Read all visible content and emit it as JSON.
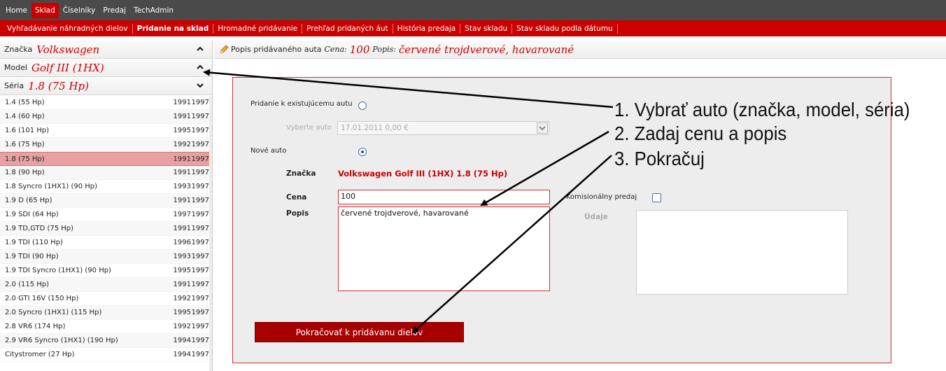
{
  "topnav": [
    {
      "label": "Home",
      "active": false
    },
    {
      "label": "Sklad",
      "active": true
    },
    {
      "label": "Číselníky",
      "active": false
    },
    {
      "label": "Predaj",
      "active": false
    },
    {
      "label": "TechAdmin",
      "active": false
    }
  ],
  "subnav": [
    {
      "label": "Vyhľadávanie náhradných dielov",
      "active": false
    },
    {
      "label": "Pridanie na sklad",
      "active": true
    },
    {
      "label": "Hromadné pridávanie",
      "active": false
    },
    {
      "label": "Prehľad pridaných áut",
      "active": false
    },
    {
      "label": "História predaja",
      "active": false
    },
    {
      "label": "Stav skladu",
      "active": false
    },
    {
      "label": "Stav skladu podla dátumu",
      "active": false
    }
  ],
  "left": {
    "znacka_label": "Značka",
    "znacka_value": "Volkswagen",
    "model_label": "Model",
    "model_value": "Golf III (1HX)",
    "seria_label": "Séria",
    "seria_value": "1.8 (75 Hp)",
    "rows": [
      {
        "name": "1.4 (55 Hp)",
        "from": "1991",
        "to": "1997"
      },
      {
        "name": "1.4 (60 Hp)",
        "from": "1991",
        "to": "1997"
      },
      {
        "name": "1.6 (101 Hp)",
        "from": "1995",
        "to": "1997"
      },
      {
        "name": "1.6 (75 Hp)",
        "from": "1992",
        "to": "1997"
      },
      {
        "name": "1.8 (75 Hp)",
        "from": "1991",
        "to": "1997",
        "selected": true
      },
      {
        "name": "1.8 (90 Hp)",
        "from": "1991",
        "to": "1997"
      },
      {
        "name": "1.8 Syncro (1HX1) (90 Hp)",
        "from": "1993",
        "to": "1997"
      },
      {
        "name": "1.9 D (65 Hp)",
        "from": "1991",
        "to": "1997"
      },
      {
        "name": "1.9 SDI (64 Hp)",
        "from": "1997",
        "to": "1997"
      },
      {
        "name": "1.9 TD,GTD (75 Hp)",
        "from": "1991",
        "to": "1997"
      },
      {
        "name": "1.9 TDI (110 Hp)",
        "from": "1996",
        "to": "1997"
      },
      {
        "name": "1.9 TDI (90 Hp)",
        "from": "1993",
        "to": "1997"
      },
      {
        "name": "1.9 TDI Syncro (1HX1) (90 Hp)",
        "from": "1995",
        "to": "1997"
      },
      {
        "name": "2.0 (115 Hp)",
        "from": "1991",
        "to": "1997"
      },
      {
        "name": "2.0 GTI 16V (150 Hp)",
        "from": "1992",
        "to": "1997"
      },
      {
        "name": "2.0 Syncro (1HX1) (115 Hp)",
        "from": "1995",
        "to": "1997"
      },
      {
        "name": "2.8 VR6 (174 Hp)",
        "from": "1992",
        "to": "1997"
      },
      {
        "name": "2.9 VR6 Syncro (1HX1) (190 Hp)",
        "from": "1994",
        "to": "1997"
      },
      {
        "name": "Citystromer (27 Hp)",
        "from": "1994",
        "to": "1997"
      }
    ]
  },
  "header": {
    "title": "Popis pridávaného auta",
    "cena_label": "Cena:",
    "cena_value": "100",
    "popis_label": "Popis:",
    "popis_value": "červené trojdverové, havarované"
  },
  "form": {
    "existing_label": "Pridanie k existujúcemu autu",
    "existing_selected": false,
    "vyberte_label": "Vyberte auto",
    "vyberte_value": "17.01.2011  0,00 €",
    "new_label": "Nové auto",
    "new_selected": true,
    "znacka_label": "Značka",
    "znacka_value": "Volkswagen Golf III (1HX) 1.8 (75 Hp)",
    "cena_label": "Cena",
    "cena_value": "100",
    "popis_label": "Popis",
    "popis_value": "červené trojdverové, havarované",
    "komis_label": "Komisionálny predaj",
    "komis_checked": false,
    "udaje_label": "Údaje",
    "continue_button": "Pokračovať k pridávanu dielov"
  },
  "annotations": [
    "1. Vybrať auto (značka, model, séria)",
    "2. Zadaj cenu a popis",
    "3. Pokračuj"
  ],
  "colors": {
    "accent": "#cc0000",
    "nav": "#4a4a4a",
    "button": "#a80000"
  }
}
